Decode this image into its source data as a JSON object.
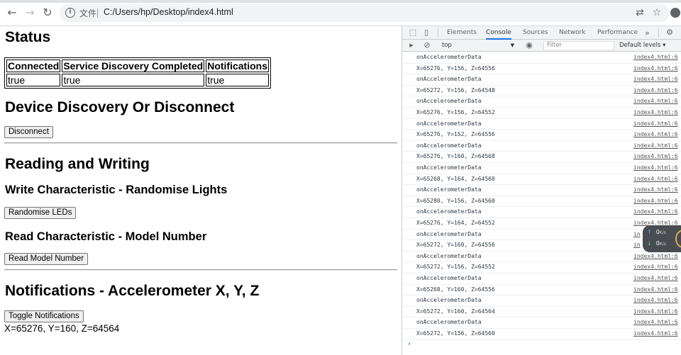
{
  "browser": {
    "scheme_label": "文件",
    "url": "C:/Users/hp/Desktop/index4.html"
  },
  "page": {
    "status_heading": "Status",
    "status_table": {
      "headers": [
        "Connected",
        "Service Discovery Completed",
        "Notifications"
      ],
      "values": [
        "true",
        "true",
        "true"
      ]
    },
    "discovery_heading": "Device Discovery Or Disconnect",
    "disconnect_button": "Disconnect",
    "rw_heading": "Reading and Writing",
    "write_heading": "Write Characteristic - Randomise Lights",
    "randomise_button": "Randomise LEDs",
    "read_heading": "Read Characteristic - Model Number",
    "read_button": "Read Model Number",
    "notif_heading": "Notifications - Accelerometer X, Y, Z",
    "toggle_button": "Toggle Notifications",
    "accel_result": "X=65276, Y=160, Z=64564"
  },
  "devtools": {
    "tabs": [
      "Elements",
      "Console",
      "Sources",
      "Network",
      "Performance"
    ],
    "active_tab": "Console",
    "more_label": "»",
    "context": "top",
    "filter_placeholder": "Filter",
    "levels_label": "Default levels ▾",
    "prompt": "›",
    "log_rows": [
      {
        "msg": "onAccelerometerData",
        "src": "index4.html:6"
      },
      {
        "msg": "X=65276, Y=156, Z=64556",
        "src": "index4.html:6"
      },
      {
        "msg": "onAccelerometerData",
        "src": "index4.html:6"
      },
      {
        "msg": "X=65272, Y=156, Z=64548",
        "src": "index4.html:6"
      },
      {
        "msg": "onAccelerometerData",
        "src": "index4.html:6"
      },
      {
        "msg": "X=65276, Y=156, Z=64552",
        "src": "index4.html:6"
      },
      {
        "msg": "onAccelerometerData",
        "src": "index4.html:6"
      },
      {
        "msg": "X=65276, Y=152, Z=64556",
        "src": "index4.html:6"
      },
      {
        "msg": "onAccelerometerData",
        "src": "index4.html:6"
      },
      {
        "msg": "X=65276, Y=160, Z=64568",
        "src": "index4.html:6"
      },
      {
        "msg": "onAccelerometerData",
        "src": "index4.html:6"
      },
      {
        "msg": "X=65268, Y=164, Z=64560",
        "src": "index4.html:6"
      },
      {
        "msg": "onAccelerometerData",
        "src": "index4.html:6"
      },
      {
        "msg": "X=65280, Y=156, Z=64560",
        "src": "index4.html:6"
      },
      {
        "msg": "onAccelerometerData",
        "src": "index4.html:6"
      },
      {
        "msg": "X=65276, Y=164, Z=64552",
        "src": "index4.html:6"
      },
      {
        "msg": "onAccelerometerData",
        "src": "in"
      },
      {
        "msg": "X=65272, Y=160, Z=64556",
        "src": "in"
      },
      {
        "msg": "onAccelerometerData",
        "src": "index4.html:6"
      },
      {
        "msg": "X=65272, Y=156, Z=64552",
        "src": "index4.html:6"
      },
      {
        "msg": "onAccelerometerData",
        "src": "index4.html:6"
      },
      {
        "msg": "X=65268, Y=160, Z=64556",
        "src": "index4.html:6"
      },
      {
        "msg": "onAccelerometerData",
        "src": "index4.html:6"
      },
      {
        "msg": "X=65272, Y=160, Z=64564",
        "src": "index4.html:6"
      },
      {
        "msg": "onAccelerometerData",
        "src": "index4.html:6"
      },
      {
        "msg": "X=65272, Y=156, Z=64560",
        "src": "index4.html:6"
      }
    ]
  },
  "speed_widget": {
    "upload": "0",
    "download": "0",
    "unit": "K/s"
  }
}
